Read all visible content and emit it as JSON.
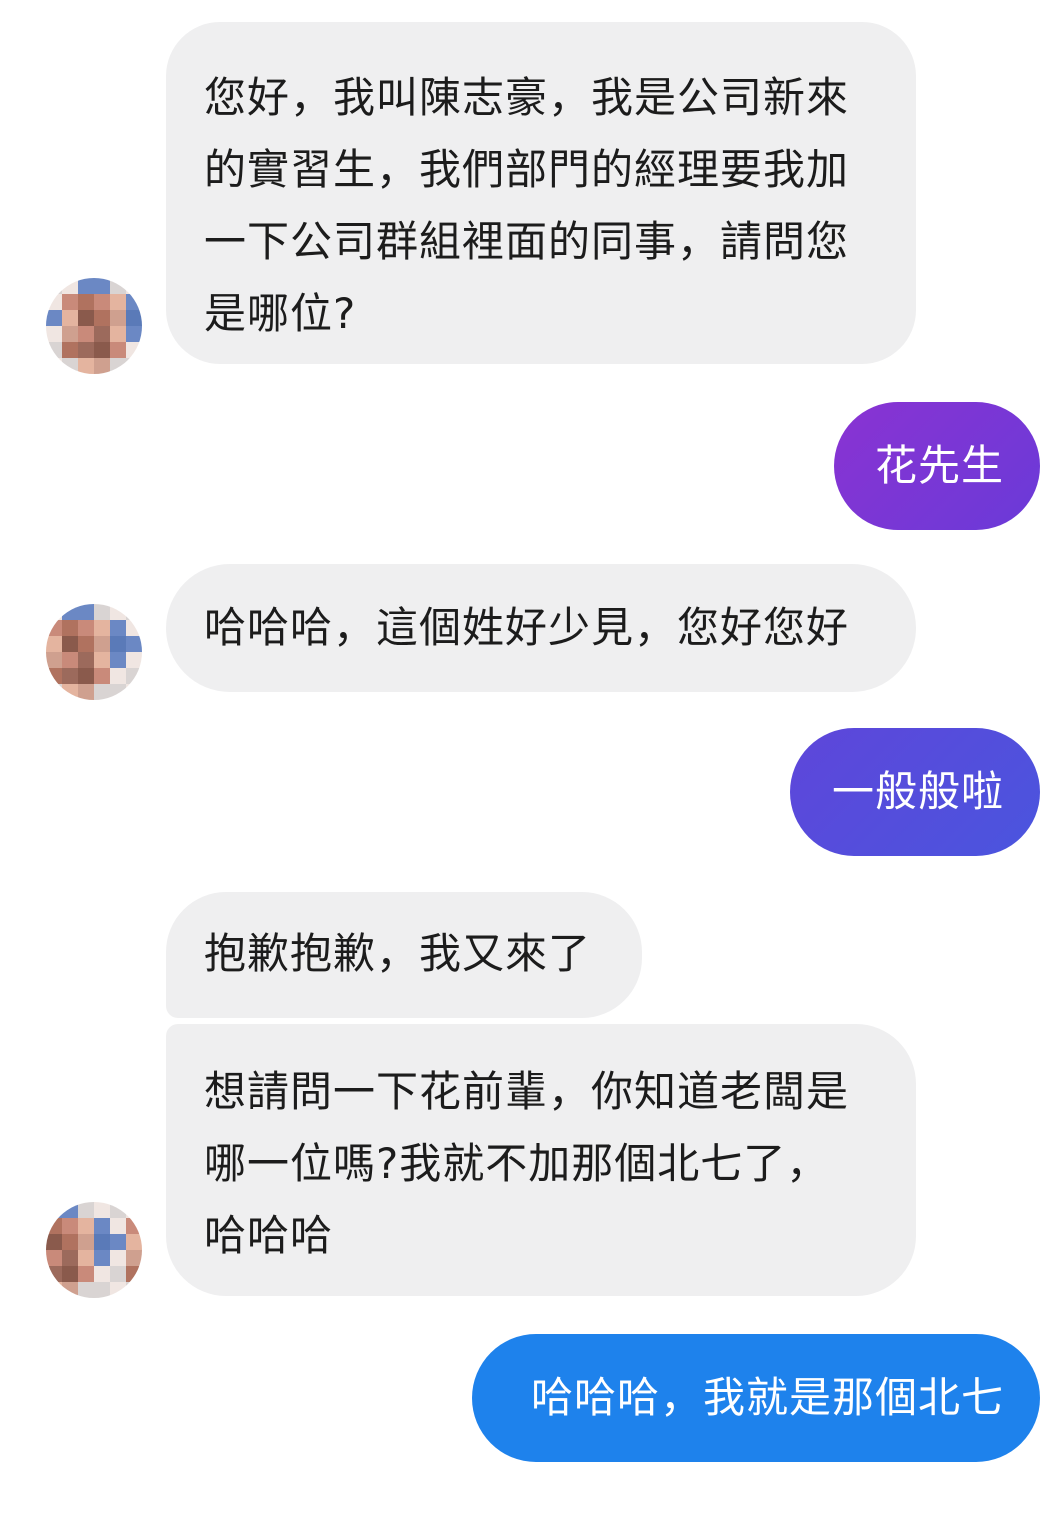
{
  "messages": [
    {
      "from": "contact",
      "lines": [
        "您好，我叫陳志豪，我是公司新來",
        "的實習生，我們部門的經理要我加",
        "一下公司群組裡面的同事，請問您",
        "是哪位?"
      ]
    },
    {
      "from": "me",
      "text": "花先生"
    },
    {
      "from": "contact",
      "lines": [
        "哈哈哈，這個姓好少見，您好您好"
      ]
    },
    {
      "from": "me",
      "text": "一般般啦"
    },
    {
      "from": "contact",
      "lines": [
        "抱歉抱歉，我又來了"
      ]
    },
    {
      "from": "contact",
      "lines": [
        "想請問一下花前輩，你知道老闆是",
        "哪一位嗎?我就不加那個北七了，",
        "哈哈哈"
      ]
    },
    {
      "from": "me",
      "text": "哈哈哈，我就是那個北七"
    }
  ],
  "colors": {
    "incoming_bubble": "#efeff0",
    "incoming_text": "#1c1c1c",
    "outgoing_text": "#ffffff",
    "outgoing_purple": "#7a36d6",
    "outgoing_indigo": "#5a49dc",
    "outgoing_blue": "#1e82ec"
  },
  "avatar": {
    "icon": "pixelated-contact-avatar-icon",
    "palette": [
      "#c98a7a",
      "#b0725f",
      "#e4b49f",
      "#8a5a4c",
      "#d9d4d3",
      "#6b88c4",
      "#f0e6e2",
      "#9c6a5c",
      "#cfa08f",
      "#5a7ab8"
    ]
  }
}
